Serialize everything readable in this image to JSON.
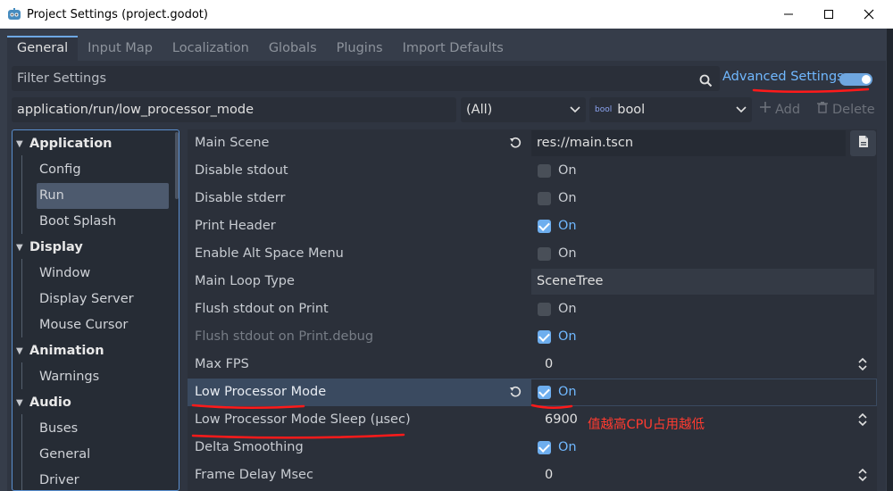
{
  "window": {
    "title": "Project Settings (project.godot)"
  },
  "tabs": [
    "General",
    "Input Map",
    "Localization",
    "Globals",
    "Plugins",
    "Import Defaults"
  ],
  "filter": {
    "placeholder": "Filter Settings",
    "icon": "search-icon"
  },
  "advanced": {
    "label": "Advanced Settings",
    "enabled": true
  },
  "property_path": {
    "value": "application/run/low_processor_mode"
  },
  "scope_select": {
    "value": "(All)"
  },
  "type_select": {
    "value": "bool",
    "icon": "bool"
  },
  "toolbar": {
    "add_label": "Add",
    "delete_label": "Delete"
  },
  "tree": {
    "items": [
      {
        "label": "Application",
        "kind": "section"
      },
      {
        "label": "Config",
        "kind": "leaf"
      },
      {
        "label": "Run",
        "kind": "leaf",
        "selected": true
      },
      {
        "label": "Boot Splash",
        "kind": "leaf"
      },
      {
        "label": "Display",
        "kind": "section"
      },
      {
        "label": "Window",
        "kind": "leaf"
      },
      {
        "label": "Display Server",
        "kind": "leaf"
      },
      {
        "label": "Mouse Cursor",
        "kind": "leaf"
      },
      {
        "label": "Animation",
        "kind": "section"
      },
      {
        "label": "Warnings",
        "kind": "leaf"
      },
      {
        "label": "Audio",
        "kind": "section"
      },
      {
        "label": "Buses",
        "kind": "leaf"
      },
      {
        "label": "General",
        "kind": "leaf"
      },
      {
        "label": "Driver",
        "kind": "leaf"
      }
    ]
  },
  "properties": [
    {
      "label": "Main Scene",
      "type": "file",
      "value": "res://main.tscn",
      "revert": true
    },
    {
      "label": "Disable stdout",
      "type": "bool",
      "checked": false,
      "text": "On"
    },
    {
      "label": "Disable stderr",
      "type": "bool",
      "checked": false,
      "text": "On"
    },
    {
      "label": "Print Header",
      "type": "bool",
      "checked": true,
      "text": "On"
    },
    {
      "label": "Enable Alt Space Menu",
      "type": "bool",
      "checked": false,
      "text": "On"
    },
    {
      "label": "Main Loop Type",
      "type": "string",
      "value": "SceneTree"
    },
    {
      "label": "Flush stdout on Print",
      "type": "bool",
      "checked": false,
      "text": "On"
    },
    {
      "label": "Flush stdout on Print.debug",
      "type": "bool",
      "checked": true,
      "text": "On",
      "dim": true
    },
    {
      "label": "Max FPS",
      "type": "int",
      "value": "0"
    },
    {
      "label": "Low Processor Mode",
      "type": "bool",
      "checked": true,
      "text": "On",
      "highlight": true,
      "revert": true
    },
    {
      "label": "Low Processor Mode Sleep (µsec)",
      "type": "int",
      "value": "6900"
    },
    {
      "label": "Delta Smoothing",
      "type": "bool",
      "checked": true,
      "text": "On"
    },
    {
      "label": "Frame Delay Msec",
      "type": "int",
      "value": "0"
    }
  ],
  "annotation": {
    "text": "值越高CPU占用越低",
    "color": "#ff3b30"
  }
}
